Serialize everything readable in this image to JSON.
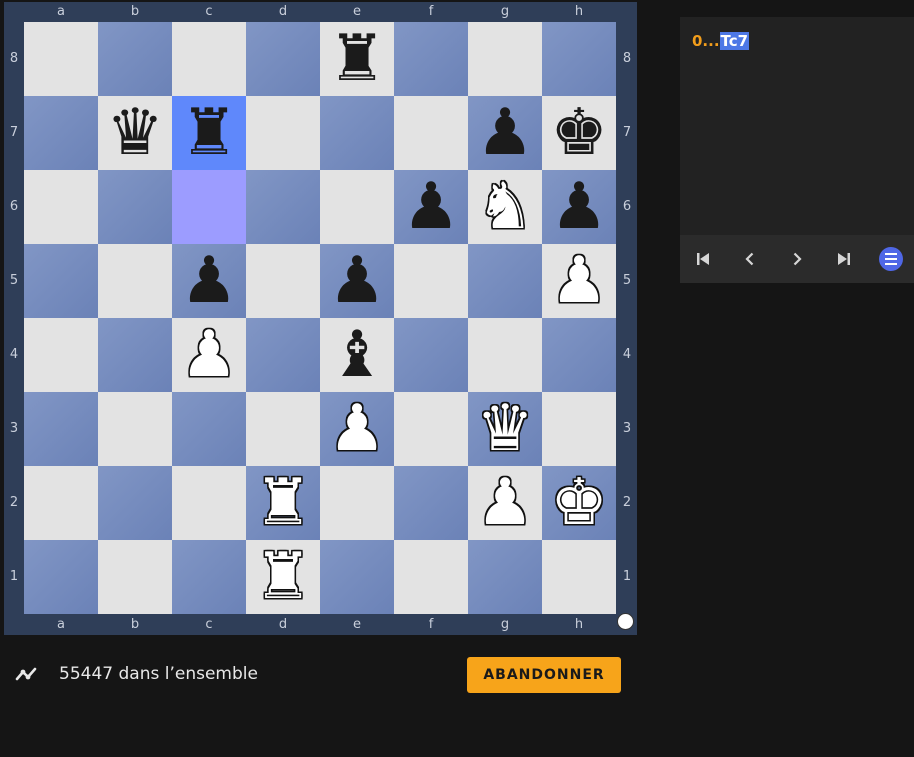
{
  "board": {
    "files": [
      "a",
      "b",
      "c",
      "d",
      "e",
      "f",
      "g",
      "h"
    ],
    "ranks": [
      "8",
      "7",
      "6",
      "5",
      "4",
      "3",
      "2",
      "1"
    ],
    "highlight": {
      "from": "c6",
      "to": "c7"
    },
    "side_to_move": "white",
    "pieces": [
      {
        "square": "e8",
        "color": "black",
        "type": "rook",
        "glyph": "♜"
      },
      {
        "square": "b7",
        "color": "black",
        "type": "queen",
        "glyph": "♛"
      },
      {
        "square": "c7",
        "color": "black",
        "type": "rook",
        "glyph": "♜"
      },
      {
        "square": "g7",
        "color": "black",
        "type": "pawn",
        "glyph": "♟"
      },
      {
        "square": "h7",
        "color": "black",
        "type": "king",
        "glyph": "♚"
      },
      {
        "square": "f6",
        "color": "black",
        "type": "pawn",
        "glyph": "♟"
      },
      {
        "square": "g6",
        "color": "white",
        "type": "knight",
        "glyph": "♞"
      },
      {
        "square": "h6",
        "color": "black",
        "type": "pawn",
        "glyph": "♟"
      },
      {
        "square": "c5",
        "color": "black",
        "type": "pawn",
        "glyph": "♟"
      },
      {
        "square": "e5",
        "color": "black",
        "type": "pawn",
        "glyph": "♟"
      },
      {
        "square": "h5",
        "color": "white",
        "type": "pawn",
        "glyph": "♟"
      },
      {
        "square": "c4",
        "color": "white",
        "type": "pawn",
        "glyph": "♟"
      },
      {
        "square": "e4",
        "color": "black",
        "type": "bishop",
        "glyph": "♝"
      },
      {
        "square": "e3",
        "color": "white",
        "type": "pawn",
        "glyph": "♟"
      },
      {
        "square": "g3",
        "color": "white",
        "type": "queen",
        "glyph": "♛"
      },
      {
        "square": "d2",
        "color": "white",
        "type": "rook",
        "glyph": "♜"
      },
      {
        "square": "g2",
        "color": "white",
        "type": "pawn",
        "glyph": "♟"
      },
      {
        "square": "h2",
        "color": "white",
        "type": "king",
        "glyph": "♚"
      },
      {
        "square": "d1",
        "color": "white",
        "type": "rook",
        "glyph": "♜"
      }
    ]
  },
  "moves": {
    "move_number": "0...",
    "move_san": "Tc7"
  },
  "nav": {
    "first_icon": "skip-first-icon",
    "prev_icon": "chevron-left-icon",
    "next_icon": "chevron-right-icon",
    "last_icon": "skip-last-icon",
    "menu_icon": "menu-icon"
  },
  "stats": {
    "text": "55447 dans l’ensemble",
    "icon": "trend-icon"
  },
  "actions": {
    "resign_label": "ABANDONNER"
  },
  "colors": {
    "light_square": "#e3e3e3",
    "dark_square": "#7489bd",
    "highlight_from": "#9c9cff",
    "highlight_to": "#5f88fb",
    "accent": "#f7a41a",
    "move_number": "#f29d1b"
  }
}
